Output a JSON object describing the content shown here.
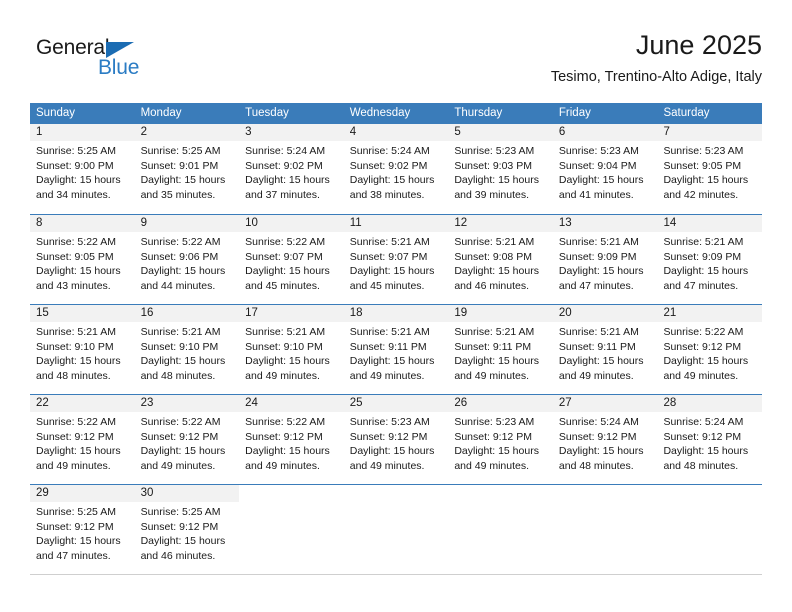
{
  "brand": {
    "name_part1": "General",
    "name_part2": "Blue",
    "triangle_icon": "blue-triangle-icon",
    "accent_dark": "#1b6cb3",
    "accent_light": "#2b7cc4"
  },
  "header": {
    "month_title": "June 2025",
    "location": "Tesimo, Trentino-Alto Adige, Italy"
  },
  "theme": {
    "header_blue": "#3a7cba",
    "daynum_band": "#f2f2f2",
    "text": "#1a1a1a"
  },
  "weekdays": [
    "Sunday",
    "Monday",
    "Tuesday",
    "Wednesday",
    "Thursday",
    "Friday",
    "Saturday"
  ],
  "weeks": [
    [
      {
        "day": "1",
        "sunrise": "Sunrise: 5:25 AM",
        "sunset": "Sunset: 9:00 PM",
        "daylight1": "Daylight: 15 hours",
        "daylight2": "and 34 minutes."
      },
      {
        "day": "2",
        "sunrise": "Sunrise: 5:25 AM",
        "sunset": "Sunset: 9:01 PM",
        "daylight1": "Daylight: 15 hours",
        "daylight2": "and 35 minutes."
      },
      {
        "day": "3",
        "sunrise": "Sunrise: 5:24 AM",
        "sunset": "Sunset: 9:02 PM",
        "daylight1": "Daylight: 15 hours",
        "daylight2": "and 37 minutes."
      },
      {
        "day": "4",
        "sunrise": "Sunrise: 5:24 AM",
        "sunset": "Sunset: 9:02 PM",
        "daylight1": "Daylight: 15 hours",
        "daylight2": "and 38 minutes."
      },
      {
        "day": "5",
        "sunrise": "Sunrise: 5:23 AM",
        "sunset": "Sunset: 9:03 PM",
        "daylight1": "Daylight: 15 hours",
        "daylight2": "and 39 minutes."
      },
      {
        "day": "6",
        "sunrise": "Sunrise: 5:23 AM",
        "sunset": "Sunset: 9:04 PM",
        "daylight1": "Daylight: 15 hours",
        "daylight2": "and 41 minutes."
      },
      {
        "day": "7",
        "sunrise": "Sunrise: 5:23 AM",
        "sunset": "Sunset: 9:05 PM",
        "daylight1": "Daylight: 15 hours",
        "daylight2": "and 42 minutes."
      }
    ],
    [
      {
        "day": "8",
        "sunrise": "Sunrise: 5:22 AM",
        "sunset": "Sunset: 9:05 PM",
        "daylight1": "Daylight: 15 hours",
        "daylight2": "and 43 minutes."
      },
      {
        "day": "9",
        "sunrise": "Sunrise: 5:22 AM",
        "sunset": "Sunset: 9:06 PM",
        "daylight1": "Daylight: 15 hours",
        "daylight2": "and 44 minutes."
      },
      {
        "day": "10",
        "sunrise": "Sunrise: 5:22 AM",
        "sunset": "Sunset: 9:07 PM",
        "daylight1": "Daylight: 15 hours",
        "daylight2": "and 45 minutes."
      },
      {
        "day": "11",
        "sunrise": "Sunrise: 5:21 AM",
        "sunset": "Sunset: 9:07 PM",
        "daylight1": "Daylight: 15 hours",
        "daylight2": "and 45 minutes."
      },
      {
        "day": "12",
        "sunrise": "Sunrise: 5:21 AM",
        "sunset": "Sunset: 9:08 PM",
        "daylight1": "Daylight: 15 hours",
        "daylight2": "and 46 minutes."
      },
      {
        "day": "13",
        "sunrise": "Sunrise: 5:21 AM",
        "sunset": "Sunset: 9:09 PM",
        "daylight1": "Daylight: 15 hours",
        "daylight2": "and 47 minutes."
      },
      {
        "day": "14",
        "sunrise": "Sunrise: 5:21 AM",
        "sunset": "Sunset: 9:09 PM",
        "daylight1": "Daylight: 15 hours",
        "daylight2": "and 47 minutes."
      }
    ],
    [
      {
        "day": "15",
        "sunrise": "Sunrise: 5:21 AM",
        "sunset": "Sunset: 9:10 PM",
        "daylight1": "Daylight: 15 hours",
        "daylight2": "and 48 minutes."
      },
      {
        "day": "16",
        "sunrise": "Sunrise: 5:21 AM",
        "sunset": "Sunset: 9:10 PM",
        "daylight1": "Daylight: 15 hours",
        "daylight2": "and 48 minutes."
      },
      {
        "day": "17",
        "sunrise": "Sunrise: 5:21 AM",
        "sunset": "Sunset: 9:10 PM",
        "daylight1": "Daylight: 15 hours",
        "daylight2": "and 49 minutes."
      },
      {
        "day": "18",
        "sunrise": "Sunrise: 5:21 AM",
        "sunset": "Sunset: 9:11 PM",
        "daylight1": "Daylight: 15 hours",
        "daylight2": "and 49 minutes."
      },
      {
        "day": "19",
        "sunrise": "Sunrise: 5:21 AM",
        "sunset": "Sunset: 9:11 PM",
        "daylight1": "Daylight: 15 hours",
        "daylight2": "and 49 minutes."
      },
      {
        "day": "20",
        "sunrise": "Sunrise: 5:21 AM",
        "sunset": "Sunset: 9:11 PM",
        "daylight1": "Daylight: 15 hours",
        "daylight2": "and 49 minutes."
      },
      {
        "day": "21",
        "sunrise": "Sunrise: 5:22 AM",
        "sunset": "Sunset: 9:12 PM",
        "daylight1": "Daylight: 15 hours",
        "daylight2": "and 49 minutes."
      }
    ],
    [
      {
        "day": "22",
        "sunrise": "Sunrise: 5:22 AM",
        "sunset": "Sunset: 9:12 PM",
        "daylight1": "Daylight: 15 hours",
        "daylight2": "and 49 minutes."
      },
      {
        "day": "23",
        "sunrise": "Sunrise: 5:22 AM",
        "sunset": "Sunset: 9:12 PM",
        "daylight1": "Daylight: 15 hours",
        "daylight2": "and 49 minutes."
      },
      {
        "day": "24",
        "sunrise": "Sunrise: 5:22 AM",
        "sunset": "Sunset: 9:12 PM",
        "daylight1": "Daylight: 15 hours",
        "daylight2": "and 49 minutes."
      },
      {
        "day": "25",
        "sunrise": "Sunrise: 5:23 AM",
        "sunset": "Sunset: 9:12 PM",
        "daylight1": "Daylight: 15 hours",
        "daylight2": "and 49 minutes."
      },
      {
        "day": "26",
        "sunrise": "Sunrise: 5:23 AM",
        "sunset": "Sunset: 9:12 PM",
        "daylight1": "Daylight: 15 hours",
        "daylight2": "and 49 minutes."
      },
      {
        "day": "27",
        "sunrise": "Sunrise: 5:24 AM",
        "sunset": "Sunset: 9:12 PM",
        "daylight1": "Daylight: 15 hours",
        "daylight2": "and 48 minutes."
      },
      {
        "day": "28",
        "sunrise": "Sunrise: 5:24 AM",
        "sunset": "Sunset: 9:12 PM",
        "daylight1": "Daylight: 15 hours",
        "daylight2": "and 48 minutes."
      }
    ],
    [
      {
        "day": "29",
        "sunrise": "Sunrise: 5:25 AM",
        "sunset": "Sunset: 9:12 PM",
        "daylight1": "Daylight: 15 hours",
        "daylight2": "and 47 minutes."
      },
      {
        "day": "30",
        "sunrise": "Sunrise: 5:25 AM",
        "sunset": "Sunset: 9:12 PM",
        "daylight1": "Daylight: 15 hours",
        "daylight2": "and 46 minutes."
      },
      {
        "day": "",
        "sunrise": "",
        "sunset": "",
        "daylight1": "",
        "daylight2": ""
      },
      {
        "day": "",
        "sunrise": "",
        "sunset": "",
        "daylight1": "",
        "daylight2": ""
      },
      {
        "day": "",
        "sunrise": "",
        "sunset": "",
        "daylight1": "",
        "daylight2": ""
      },
      {
        "day": "",
        "sunrise": "",
        "sunset": "",
        "daylight1": "",
        "daylight2": ""
      },
      {
        "day": "",
        "sunrise": "",
        "sunset": "",
        "daylight1": "",
        "daylight2": ""
      }
    ]
  ]
}
